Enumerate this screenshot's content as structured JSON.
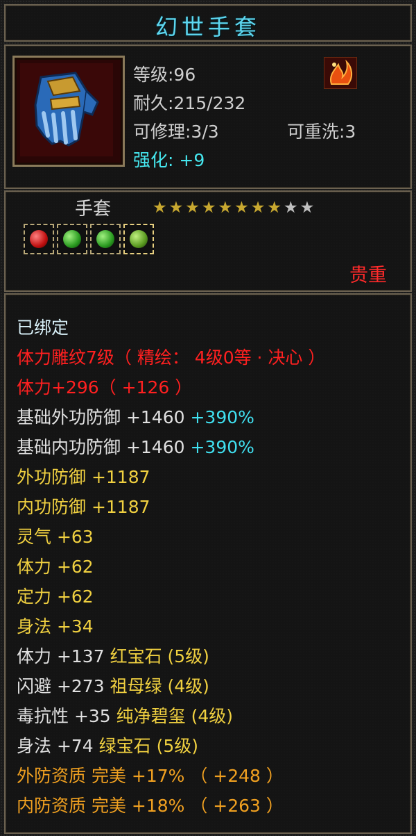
{
  "item": {
    "name": "幻世手套",
    "level": "等级:96",
    "durability": "耐久:215/232",
    "repair": "可修理:3/3",
    "rewash": "可重洗:3",
    "enhance": "强化: +9",
    "type": "手套",
    "rarity": "贵重",
    "stars_filled": 8,
    "stars_total": 10,
    "gems": [
      "red-gem",
      "green-gem",
      "green-gem",
      "green-gem"
    ]
  },
  "attributes": {
    "bound": "已绑定",
    "engrave": "体力雕纹7级（ 精绘： 4级0等 · 决心 ）",
    "stamina_engrave": "体力+296（ +126 ）",
    "base_ext_def_label": "基础外功防御 +1460 ",
    "base_ext_def_pct": "+390%",
    "base_int_def_label": "基础内功防御 +1460 ",
    "base_int_def_pct": "+390%",
    "ext_def": "外功防御 +1187",
    "int_def": "内功防御 +1187",
    "spirit": "灵气 +63",
    "stamina": "体力 +62",
    "focus": "定力 +62",
    "agility": "身法 +34",
    "gem1_stat": "体力 +137 ",
    "gem1_name": "红宝石 (5级)",
    "gem2_stat": "闪避 +273 ",
    "gem2_name": "祖母绿 (4级)",
    "gem3_stat": "毒抗性 +35 ",
    "gem3_name": "纯净碧玺 (4级)",
    "gem4_stat": "身法 +74 ",
    "gem4_name": "绿宝石 (5级)",
    "ext_quality": "外防资质   完美 +17% （ +248 ）",
    "int_quality": "内防资质   完美 +18% （ +263 ）"
  },
  "colors": {
    "title": "#5ed7f0",
    "enhance": "#46e8f0",
    "rarity": "#ff2a2a",
    "engrave": "#ff2020",
    "star_filled": "#c8a830",
    "star_empty": "#bfbfbf"
  }
}
